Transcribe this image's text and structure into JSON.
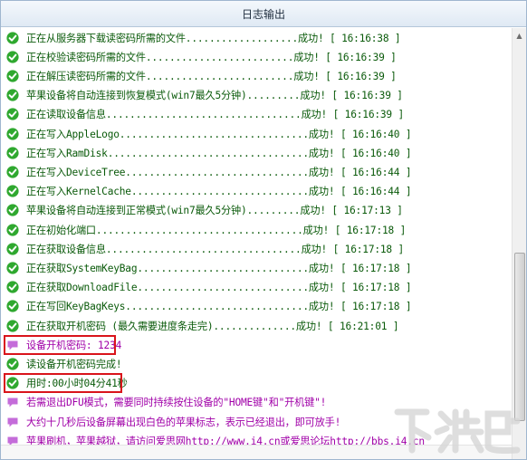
{
  "window": {
    "title": "日志输出"
  },
  "colors": {
    "success": "#2fa82f",
    "info": "#c46cd9",
    "highlight": "#d9141b"
  },
  "log": [
    {
      "type": "success",
      "icon": "check-circle-icon",
      "text": "正在从服务器下载读密码所需的文件...................成功! [ 16:16:38 ]"
    },
    {
      "type": "success",
      "icon": "check-circle-icon",
      "text": "正在校验读密码所需的文件.........................成功! [ 16:16:39 ]"
    },
    {
      "type": "success",
      "icon": "check-circle-icon",
      "text": "正在解压读密码所需的文件.........................成功! [ 16:16:39 ]"
    },
    {
      "type": "success",
      "icon": "check-circle-icon",
      "text": "苹果设备将自动连接到恢复模式(win7最久5分钟).........成功! [ 16:16:39 ]"
    },
    {
      "type": "success",
      "icon": "check-circle-icon",
      "text": "正在读取设备信息.................................成功! [ 16:16:39 ]"
    },
    {
      "type": "success",
      "icon": "check-circle-icon",
      "text": "正在写入AppleLogo................................成功! [ 16:16:40 ]"
    },
    {
      "type": "success",
      "icon": "check-circle-icon",
      "text": "正在写入RamDisk..................................成功! [ 16:16:40 ]"
    },
    {
      "type": "success",
      "icon": "check-circle-icon",
      "text": "正在写入DeviceTree...............................成功! [ 16:16:44 ]"
    },
    {
      "type": "success",
      "icon": "check-circle-icon",
      "text": "正在写入KernelCache..............................成功! [ 16:16:44 ]"
    },
    {
      "type": "success",
      "icon": "check-circle-icon",
      "text": "苹果设备将自动连接到正常模式(win7最久5分钟).........成功! [ 16:17:13 ]"
    },
    {
      "type": "success",
      "icon": "check-circle-icon",
      "text": "正在初始化端口...................................成功! [ 16:17:18 ]"
    },
    {
      "type": "success",
      "icon": "check-circle-icon",
      "text": "正在获取设备信息.................................成功! [ 16:17:18 ]"
    },
    {
      "type": "success",
      "icon": "check-circle-icon",
      "text": "正在获取SystemKeyBag.............................成功! [ 16:17:18 ]"
    },
    {
      "type": "success",
      "icon": "check-circle-icon",
      "text": "正在获取DownloadFile.............................成功! [ 16:17:18 ]"
    },
    {
      "type": "success",
      "icon": "check-circle-icon",
      "text": "正在写回KeyBagKeys...............................成功! [ 16:17:18 ]"
    },
    {
      "type": "success",
      "icon": "check-circle-icon",
      "text": "正在获取开机密码 (最久需要进度条走完)..............成功! [ 16:21:01 ]"
    },
    {
      "type": "info",
      "icon": "speech-bubble-icon",
      "text": "设备开机密码: 1234"
    },
    {
      "type": "success",
      "icon": "check-circle-icon",
      "text": "读设备开机密码完成!"
    },
    {
      "type": "success",
      "icon": "check-circle-icon",
      "text": "用时:00小时04分41秒"
    },
    {
      "type": "info",
      "icon": "speech-bubble-icon",
      "text": "若需退出DFU模式，需要同时持续按住设备的\"HOME键\"和\"开机键\"!"
    },
    {
      "type": "info",
      "icon": "speech-bubble-icon",
      "text": "大约十几秒后设备屏幕出现白色的苹果标志，表示已经退出，即可放手!"
    },
    {
      "type": "info",
      "icon": "speech-bubble-icon",
      "text": "苹果刷机，苹果越狱，请访问爱思网http://www.i4.cn或爱思论坛http://bbs.i4.cn"
    }
  ],
  "highlights": [
    16,
    18
  ],
  "watermark": {
    "text": "下载吧"
  }
}
